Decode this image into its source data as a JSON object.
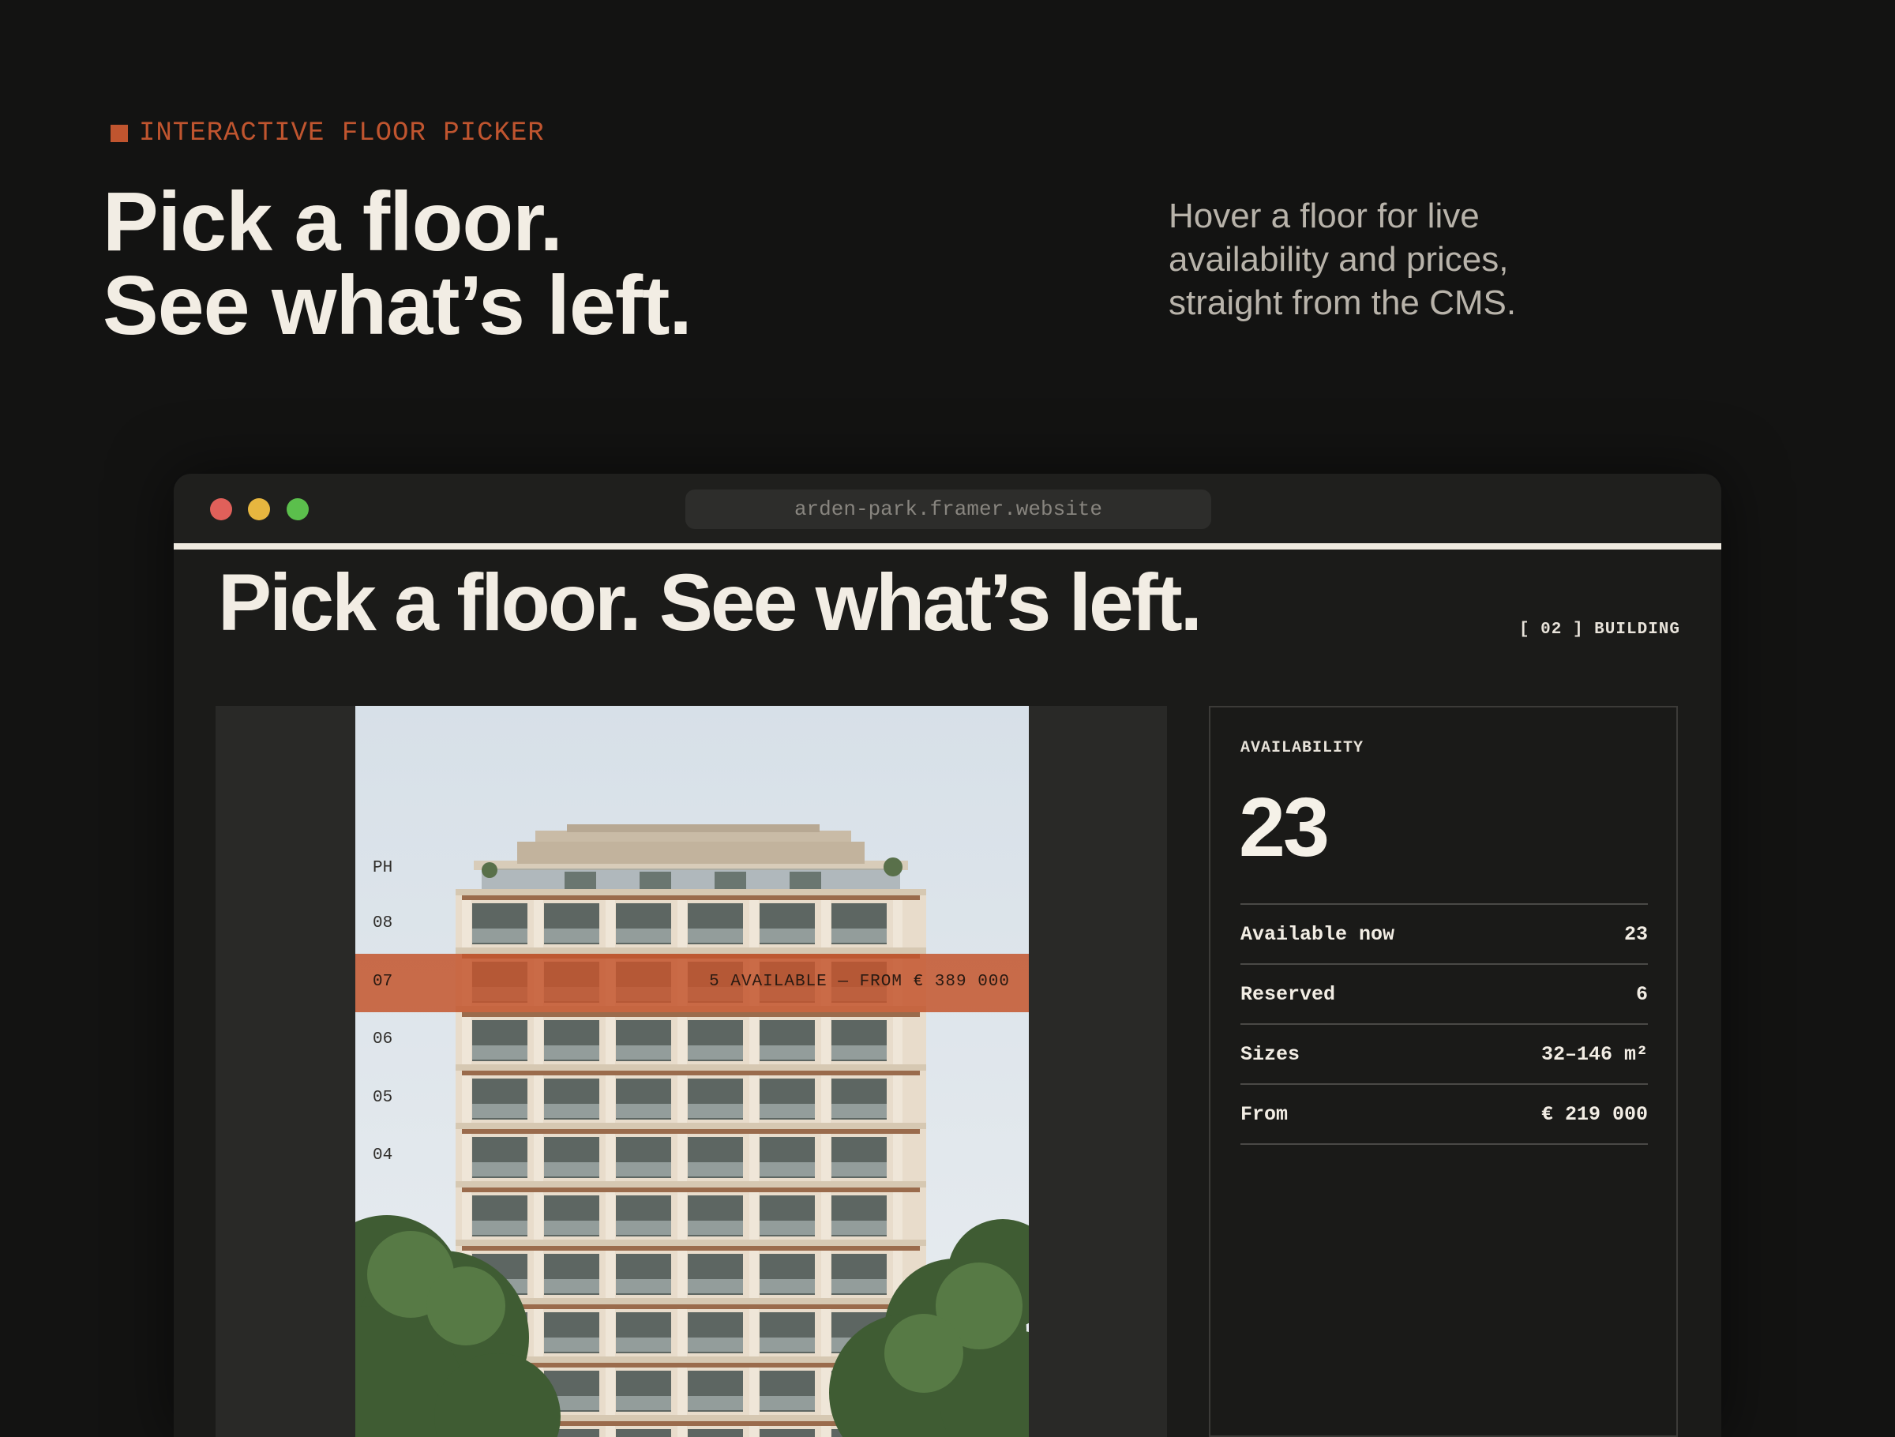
{
  "hero": {
    "eyebrow": "INTERACTIVE FLOOR PICKER",
    "title_line1": "Pick a floor.",
    "title_line2": "See what’s left.",
    "subtitle_line1": "Hover a floor for live",
    "subtitle_line2": "availability and prices,",
    "subtitle_line3": "straight from the CMS."
  },
  "browser": {
    "url": "arden-park.framer.website"
  },
  "site": {
    "title": "Pick a floor. See what’s left.",
    "section_tag": "[ 02 ] BUILDING"
  },
  "floors": {
    "labels": [
      "PH",
      "08",
      "07",
      "06",
      "05",
      "04"
    ],
    "hovered": {
      "number": "07",
      "info": "5 AVAILABLE — FROM € 389 000"
    }
  },
  "availability": {
    "label": "AVAILABILITY",
    "count": "23",
    "rows": [
      {
        "label": "Available now",
        "value": "23"
      },
      {
        "label": "Reserved",
        "value": "6"
      },
      {
        "label": "Sizes",
        "value": "32–146 m²"
      },
      {
        "label": "From",
        "value": "€ 219 000"
      }
    ]
  },
  "colors": {
    "accent": "#c0552f",
    "background": "#131312",
    "text": "#f2ede4"
  }
}
